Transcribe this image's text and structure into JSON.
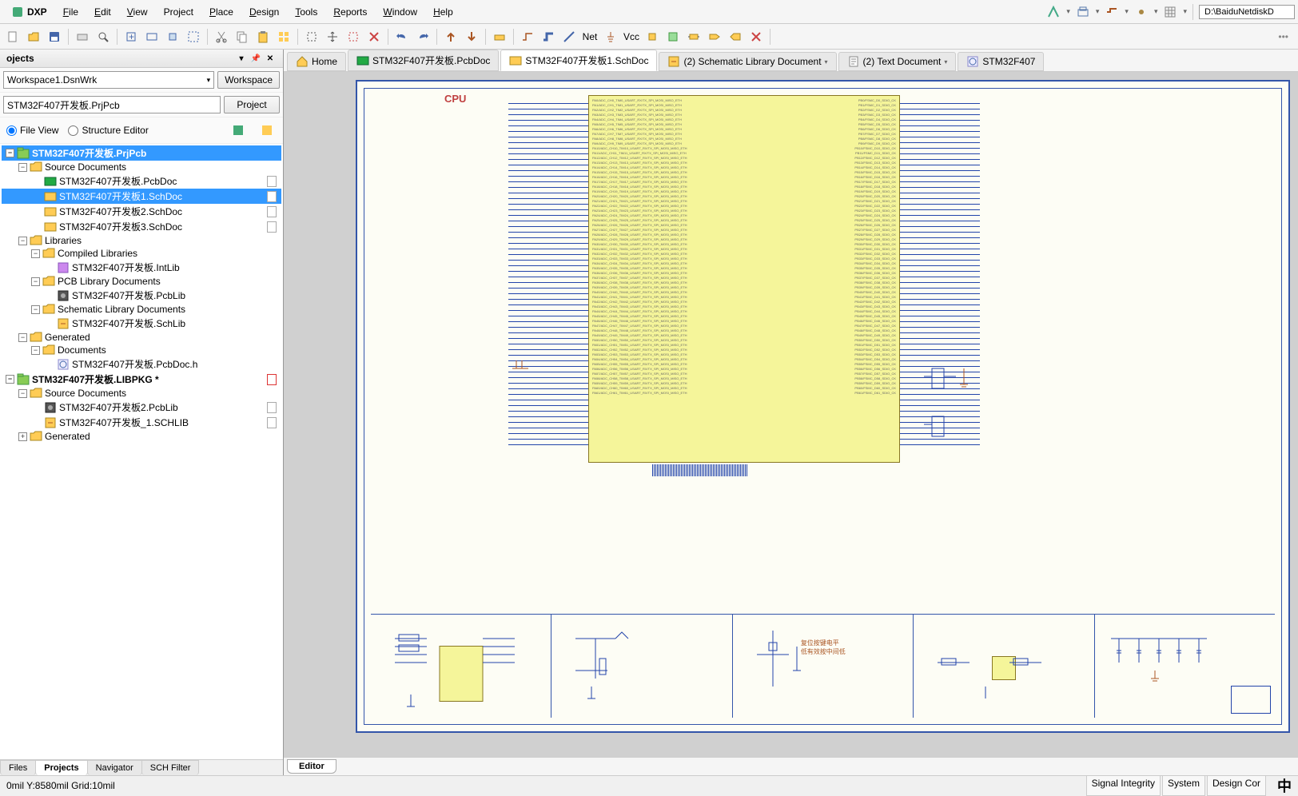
{
  "menu": {
    "logo": "DXP",
    "items": [
      "File",
      "Edit",
      "View",
      "Project",
      "Place",
      "Design",
      "Tools",
      "Reports",
      "Window",
      "Help"
    ],
    "path": "D:\\BaiduNetdiskD"
  },
  "panel": {
    "title": "ojects",
    "workspace_combo": "Workspace1.DsnWrk",
    "workspace_btn": "Workspace",
    "project_combo": "STM32F407开发板.PrjPcb",
    "project_btn": "Project",
    "radio_file": "File View",
    "radio_struct": "Structure Editor"
  },
  "tree": [
    {
      "level": 0,
      "exp": "−",
      "icon": "prj",
      "label": "STM32F407开发板.PrjPcb",
      "bold": true,
      "sel": true
    },
    {
      "level": 1,
      "exp": "−",
      "icon": "folder",
      "label": "Source Documents"
    },
    {
      "level": 2,
      "exp": "",
      "icon": "pcb",
      "label": "STM32F407开发板.PcbDoc",
      "doc": true
    },
    {
      "level": 2,
      "exp": "",
      "icon": "sch",
      "label": "STM32F407开发板1.SchDoc",
      "doc": true,
      "sel2": true
    },
    {
      "level": 2,
      "exp": "",
      "icon": "sch",
      "label": "STM32F407开发板2.SchDoc",
      "doc": true
    },
    {
      "level": 2,
      "exp": "",
      "icon": "sch",
      "label": "STM32F407开发板3.SchDoc",
      "doc": true
    },
    {
      "level": 1,
      "exp": "−",
      "icon": "folder",
      "label": "Libraries"
    },
    {
      "level": 2,
      "exp": "−",
      "icon": "folder",
      "label": "Compiled Libraries"
    },
    {
      "level": 3,
      "exp": "",
      "icon": "lib",
      "label": "STM32F407开发板.IntLib"
    },
    {
      "level": 2,
      "exp": "−",
      "icon": "folder",
      "label": "PCB Library Documents"
    },
    {
      "level": 3,
      "exp": "",
      "icon": "pcblib",
      "label": "STM32F407开发板.PcbLib"
    },
    {
      "level": 2,
      "exp": "−",
      "icon": "folder",
      "label": "Schematic Library Documents"
    },
    {
      "level": 3,
      "exp": "",
      "icon": "schlib",
      "label": "STM32F407开发板.SchLib"
    },
    {
      "level": 1,
      "exp": "−",
      "icon": "folder",
      "label": "Generated"
    },
    {
      "level": 2,
      "exp": "−",
      "icon": "folder",
      "label": "Documents"
    },
    {
      "level": 3,
      "exp": "",
      "icon": "html",
      "label": "STM32F407开发板.PcbDoc.h"
    },
    {
      "level": 0,
      "exp": "−",
      "icon": "prj",
      "label": "STM32F407开发板.LIBPKG *",
      "bold": true,
      "docred": true
    },
    {
      "level": 1,
      "exp": "−",
      "icon": "folder",
      "label": "Source Documents"
    },
    {
      "level": 2,
      "exp": "",
      "icon": "pcblib",
      "label": "STM32F407开发板2.PcbLib",
      "doc": true
    },
    {
      "level": 2,
      "exp": "",
      "icon": "schlib",
      "label": "STM32F407开发板_1.SCHLIB",
      "doc": true
    },
    {
      "level": 1,
      "exp": "+",
      "icon": "folder",
      "label": "Generated"
    }
  ],
  "bottom_tabs": [
    "Files",
    "Projects",
    "Navigator",
    "SCH Filter"
  ],
  "bottom_tabs_active": 1,
  "doc_tabs": [
    {
      "icon": "home",
      "label": "Home"
    },
    {
      "icon": "pcb",
      "label": "STM32F407开发板.PcbDoc"
    },
    {
      "icon": "sch",
      "label": "STM32F407开发板1.SchDoc",
      "active": true
    },
    {
      "icon": "schlib",
      "label": "(2) Schematic Library Document",
      "dd": true
    },
    {
      "icon": "txt",
      "label": "(2) Text Document",
      "dd": true
    },
    {
      "icon": "html",
      "label": "STM32F407"
    }
  ],
  "schematic": {
    "cpu_label": "CPU",
    "sub_note": "复位按键电平\n低有效按中间低"
  },
  "editor_tab": "Editor",
  "status": {
    "left": "0mil Y:8580mil   Grid:10mil",
    "right": [
      "Signal Integrity",
      "System",
      "Design Cor"
    ]
  },
  "lang": "中"
}
